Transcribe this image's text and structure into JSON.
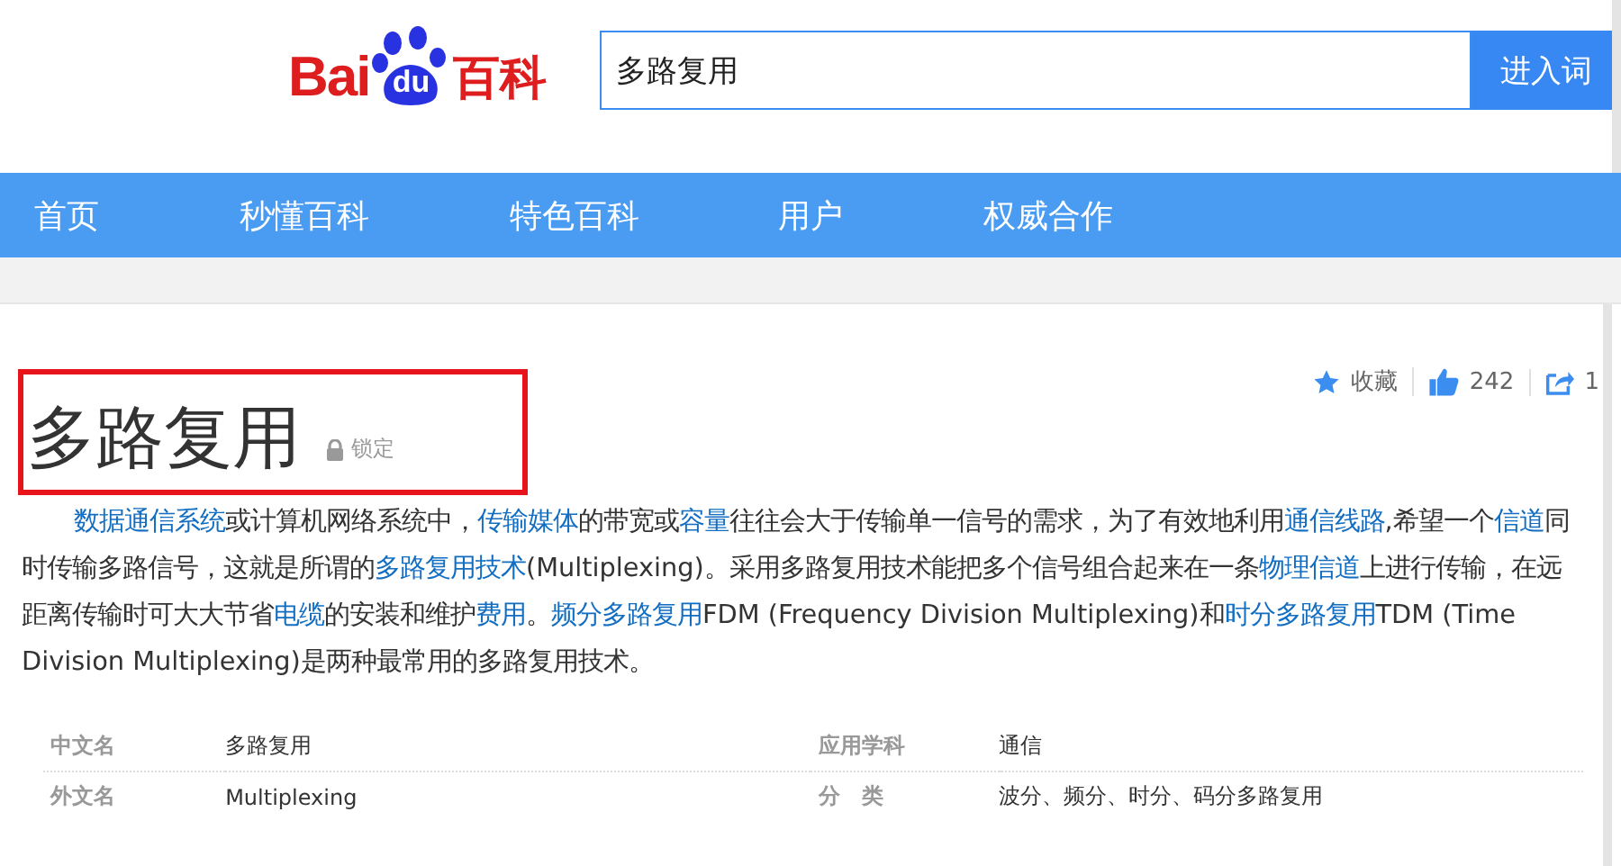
{
  "logo": {
    "left": "Bai",
    "middle": "du",
    "right": "百科"
  },
  "search": {
    "value": "多路复用",
    "button": "进入词"
  },
  "nav": [
    {
      "label": "首页"
    },
    {
      "label": "秒懂百科"
    },
    {
      "label": "特色百科"
    },
    {
      "label": "用户"
    },
    {
      "label": "权威合作"
    }
  ],
  "title": {
    "text": "多路复用",
    "highlighted": true,
    "lock_label": "锁定"
  },
  "actions": [
    {
      "kind": "star",
      "label": "收藏"
    },
    {
      "kind": "thumb",
      "label": "242"
    },
    {
      "kind": "share",
      "label": "1"
    }
  ],
  "summary": [
    {
      "text": "数据通信系统",
      "link": true
    },
    {
      "text": "或计算机网络系统中，",
      "link": false
    },
    {
      "text": "传输媒体",
      "link": true
    },
    {
      "text": "的带宽或",
      "link": false
    },
    {
      "text": "容量",
      "link": true
    },
    {
      "text": "往往会大于传输单一信号的需求，为了有效地利用",
      "link": false
    },
    {
      "text": "通信线路",
      "link": true
    },
    {
      "text": ",希望一个",
      "link": false
    },
    {
      "text": "信道",
      "link": true
    },
    {
      "text": "同时传输多路信号，这就是所谓的",
      "link": false
    },
    {
      "text": "多路复用技术",
      "link": true
    },
    {
      "text": "(Multiplexing)。采用多路复用技术能把多个信号组合起来在一条",
      "link": false
    },
    {
      "text": "物理信道",
      "link": true
    },
    {
      "text": "上进行传输，在远距离传输时可大大节省",
      "link": false
    },
    {
      "text": "电缆",
      "link": true
    },
    {
      "text": "的安装和维护",
      "link": false
    },
    {
      "text": "费用",
      "link": true
    },
    {
      "text": "。",
      "link": false
    },
    {
      "text": "频分多路复用",
      "link": true
    },
    {
      "text": "FDM (Frequency Division Multiplexing)和",
      "link": false
    },
    {
      "text": "时分多路复用",
      "link": true
    },
    {
      "text": "TDM (Time Division Multiplexing)是两种最常用的多路复用技术。",
      "link": false
    }
  ],
  "basic_info": [
    [
      {
        "name": "中文名",
        "value": "多路复用"
      },
      {
        "name": "应用学科",
        "value": "通信"
      }
    ],
    [
      {
        "name": "外文名",
        "value": "Multiplexing"
      },
      {
        "name": "分　类",
        "value": "波分、频分、时分、码分多路复用"
      }
    ]
  ]
}
